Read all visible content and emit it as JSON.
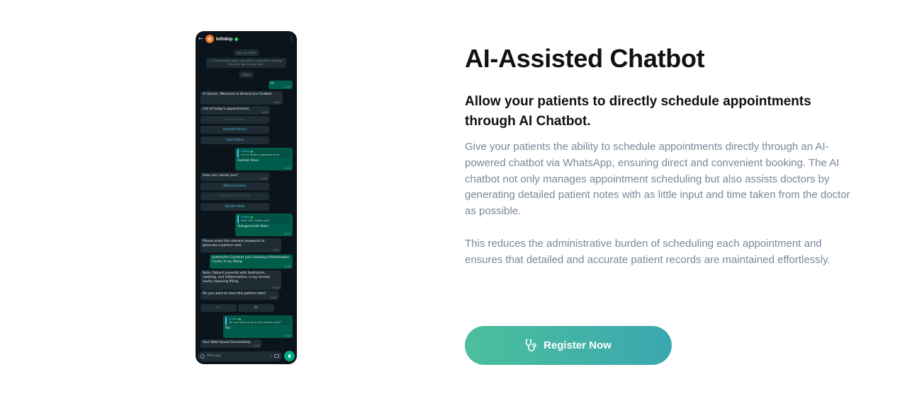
{
  "phone": {
    "contact_name": "infobip",
    "avatar_letter": "@",
    "date_pill": "May 13, 2024",
    "business_notice": "ⓘ This business works with other companies to manage this chat. Tap to learn more.",
    "today_pill": "Today",
    "messages": {
      "hi": "Hi",
      "hi_time": "14:33",
      "welcome": "Hi Doctor, Welcome to BistecCare Chatbot",
      "welcome_time": "14:33",
      "list_today": "List of today's appointments",
      "list_today_time": "14:33",
      "opt_hashan": "Hashan Silva",
      "opt_kavinda": "Kavinda Perera",
      "opt_udara": "Udara Peiris",
      "reply1_quote_name": "infobip",
      "reply1_quote_text": "List of today's appointments",
      "reply1_text": "Hashan Silva",
      "reply1_time": "14:34",
      "assist": "How can I assist you?",
      "assist_time": "14:34",
      "opt_history": "Patient History",
      "opt_autogen": "Autogenerate Note",
      "opt_dictate": "Dictate Note",
      "reply2_quote_name": "infobip",
      "reply2_quote_text": "How can I assist you?",
      "reply2_text": "Autogenerate Note",
      "reply2_time": "14:37",
      "keywords": "Please enter the relevant keywords to generate a patient note",
      "keywords_time": "14:37",
      "keywords_reply": "toothache Constant pain Swelling Inflammation Cavity X-ray Filling",
      "keywords_reply_time": "14:40",
      "note": "Note: Patient presents with toothache, swelling, and inflammation; x-ray reveals cavity requiring filling.",
      "note_time": "14:40",
      "save_q": "Do you want to save this patient note?",
      "save_q_time": "14:40",
      "opt_yes": "Yes",
      "opt_no": "No",
      "reply3_quote_name": "infobip",
      "reply3_quote_text": "Do you want to save this patient note?",
      "reply3_text": "Yes",
      "reply3_time": "14:40",
      "saved": "Your Note Saved Successfully",
      "saved_time": "14:40"
    },
    "input_placeholder": "Message"
  },
  "content": {
    "title": "AI-Assisted Chatbot",
    "subtitle": "Allow your patients to directly schedule appointments through AI Chatbot.",
    "paragraph1": "Give your patients the ability to schedule appointments directly through an AI-powered chatbot via WhatsApp, ensuring direct and convenient booking. The AI chatbot not only manages appointment scheduling but also assists doctors by generating detailed patient notes with as little input and time taken from the doctor as possible.",
    "paragraph2": "This reduces the administrative burden of scheduling each appointment and ensures that detailed and accurate patient records are maintained effortlessly.",
    "register_label": "Register Now",
    "register_icon": "stethoscope-icon"
  },
  "colors": {
    "button_gradient_start": "#4cbf9c",
    "button_gradient_end": "#3aa7b0",
    "body_text": "#7a879a",
    "chat_bg": "#0b141a",
    "outgoing_bubble": "#005c4b",
    "incoming_bubble": "#1f2c34"
  }
}
